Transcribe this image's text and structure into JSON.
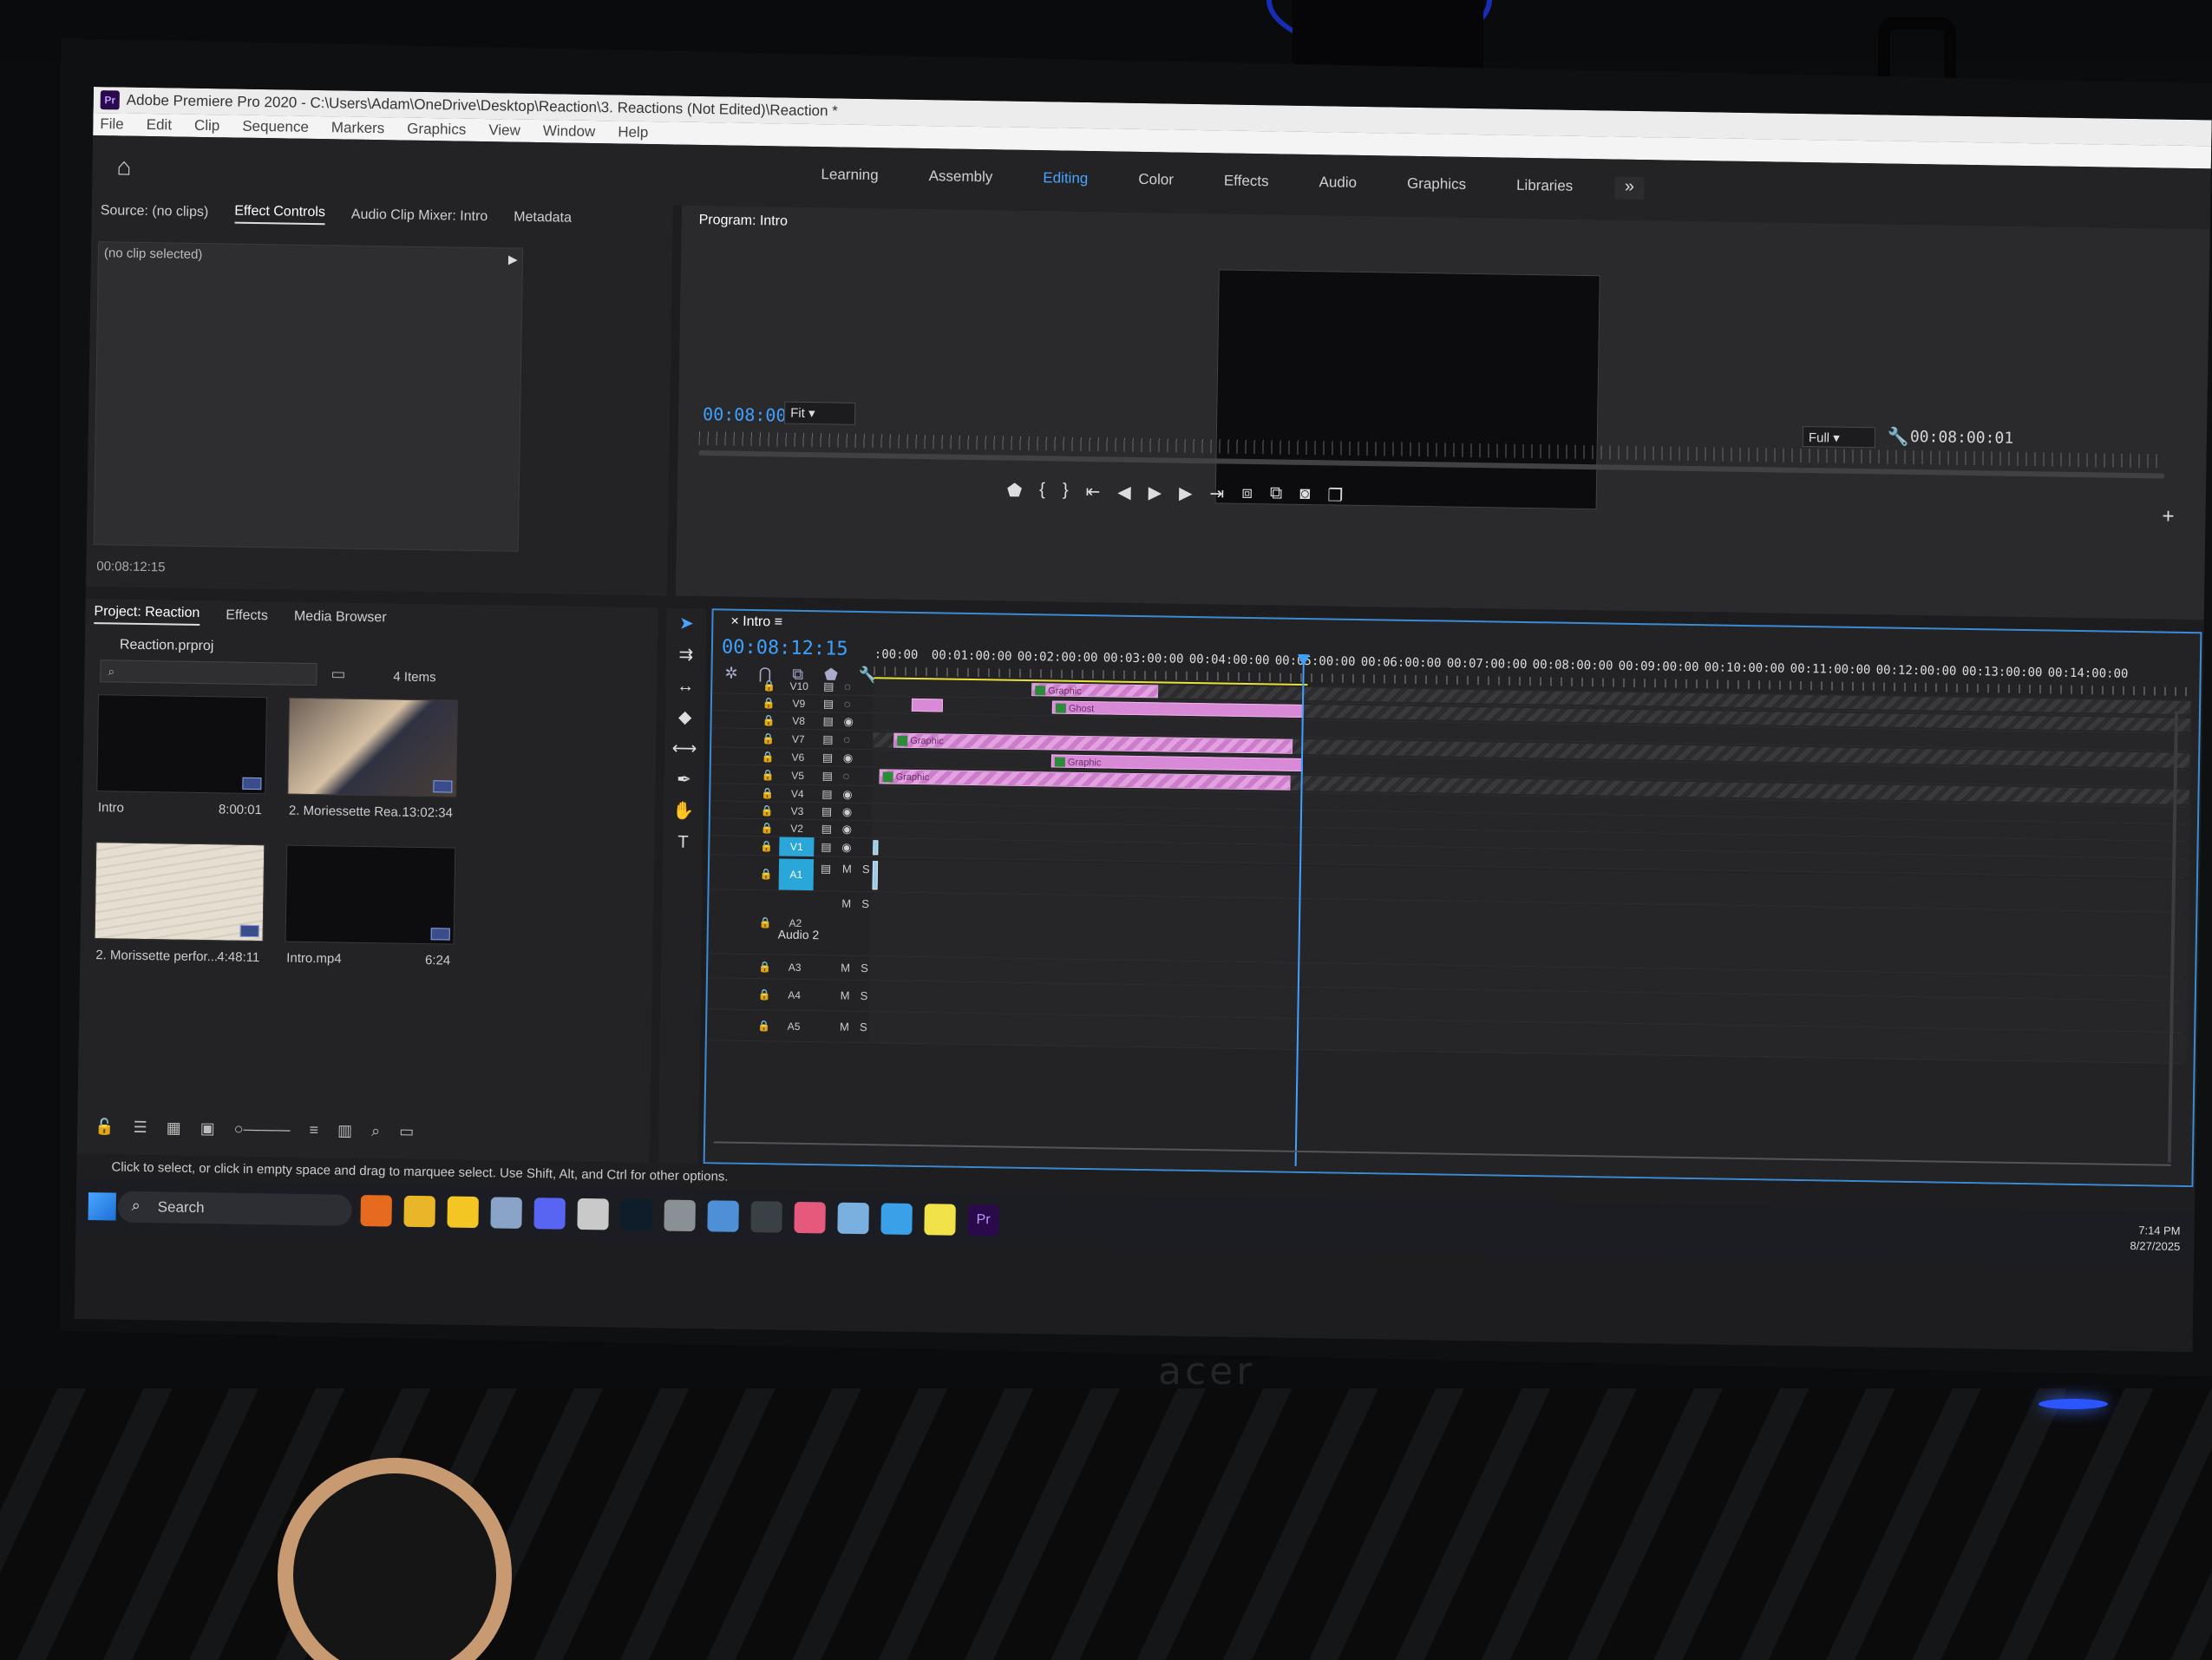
{
  "window": {
    "title": "Adobe Premiere Pro 2020 - C:\\Users\\Adam\\OneDrive\\Desktop\\Reaction\\3. Reactions (Not Edited)\\Reaction *",
    "logo": "Pr"
  },
  "menu": [
    "File",
    "Edit",
    "Clip",
    "Sequence",
    "Markers",
    "Graphics",
    "View",
    "Window",
    "Help"
  ],
  "workspaces": {
    "tabs": [
      "Learning",
      "Assembly",
      "Editing",
      "Color",
      "Effects",
      "Audio",
      "Graphics",
      "Libraries"
    ],
    "active": "Editing"
  },
  "source_panel": {
    "tabs": [
      "Source: (no clips)",
      "Effect Controls",
      "Audio Clip Mixer: Intro",
      "Metadata"
    ],
    "active_tab": "Effect Controls",
    "no_clip_text": "(no clip selected)",
    "timecode": "00:08:12:15"
  },
  "program_monitor": {
    "title": "Program: Intro",
    "timecode": "00:08:00:01",
    "fit": "Fit",
    "resolution": "Full",
    "duration": "00:08:00:01"
  },
  "project_panel": {
    "tabs": [
      "Project: Reaction",
      "Effects",
      "Media Browser"
    ],
    "active_tab": "Project: Reaction",
    "file": "Reaction.prproj",
    "item_count": "4 Items",
    "clips": [
      {
        "name": "Intro",
        "duration": "8:00:01",
        "thumb": "black"
      },
      {
        "name": "2. Moriessette Rea...",
        "duration": "13:02:34",
        "thumb": "person"
      },
      {
        "name": "2. Morissette perfor...",
        "duration": "4:48:11",
        "thumb": "paper"
      },
      {
        "name": "Intro.mp4",
        "duration": "6:24",
        "thumb": "black"
      }
    ]
  },
  "timeline": {
    "title": "Intro",
    "timecode": "00:08:12:15",
    "ruler": [
      ":00:00",
      "00:01:00:00",
      "00:02:00:00",
      "00:03:00:00",
      "00:04:00:00",
      "00:05:00:00",
      "00:06:00:00",
      "00:07:00:00",
      "00:08:00:00",
      "00:09:00:00",
      "00:10:00:00",
      "00:11:00:00",
      "00:12:00:00",
      "00:13:00:00",
      "00:14:00:00"
    ],
    "video_tracks": [
      "V10",
      "V9",
      "V8",
      "V7",
      "V6",
      "V5",
      "V4",
      "V3",
      "V2",
      "V1"
    ],
    "audio_tracks": [
      "A1",
      "A2",
      "A3",
      "A4",
      "A5"
    ],
    "audio2_name": "Audio 2",
    "clip_label": "Graphic",
    "ghost_label": "Ghost"
  },
  "status_text": "Click to select, or click in empty space and drag to marquee select. Use Shift, Alt, and Ctrl for other options.",
  "taskbar": {
    "search": "Search",
    "time": "7:14 PM",
    "date": "8/27/2025"
  },
  "colors": {
    "accent": "#3ea0ff",
    "clip_pink": "#d88ad6",
    "active_track": "#2aa6d8"
  },
  "icons": [
    "home-icon",
    "wrench-icon",
    "lock-icon",
    "eye-icon",
    "film-icon",
    "selection-tool-icon",
    "razor-icon",
    "pen-icon",
    "hand-icon",
    "type-icon",
    "play-icon",
    "search-icon"
  ]
}
